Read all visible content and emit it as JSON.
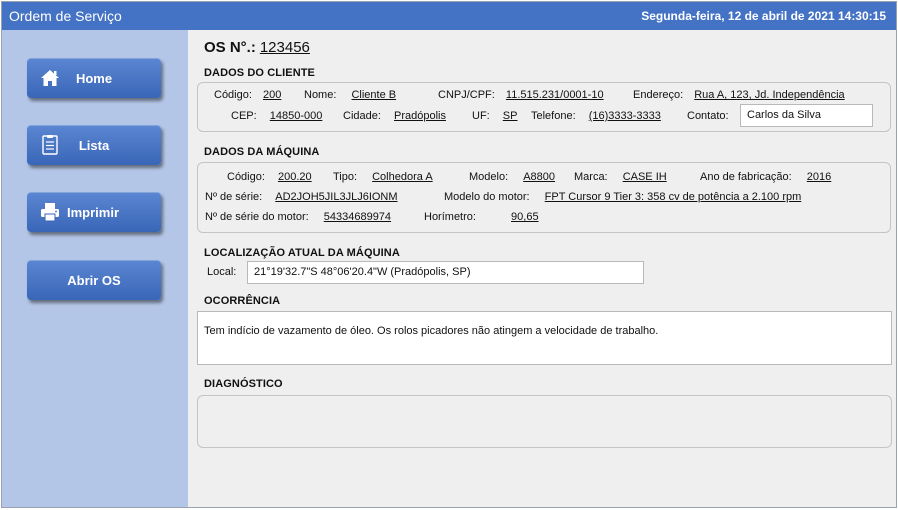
{
  "window": {
    "title": "Ordem de Serviço",
    "datetime": "Segunda-feira, 12 de abril de 2021 14:30:15"
  },
  "colors": {
    "titlebar": "#4472c4",
    "sidebar": "#b4c6e7",
    "button": "#4472c4",
    "content_bg": "#efefef"
  },
  "sidebar": {
    "home_label": "Home",
    "lista_label": "Lista",
    "imprimir_label": "Imprimir",
    "abrir_label": "Abrir OS",
    "icons": {
      "home": "home-icon",
      "lista": "list-icon",
      "imprimir": "printer-icon"
    }
  },
  "os": {
    "label": "OS N°.:",
    "number": "123456"
  },
  "cliente": {
    "section_title": "DADOS DO CLIENTE",
    "codigo_label": "Código:",
    "codigo": "200",
    "nome_label": "Nome:",
    "nome": "Cliente B",
    "cnpj_label": "CNPJ/CPF:",
    "cnpj": "11.515.231/0001-10",
    "endereco_label": "Endereço:",
    "endereco": "Rua A, 123, Jd. Independência",
    "cep_label": "CEP:",
    "cep": "14850-000",
    "cidade_label": "Cidade:",
    "cidade": "Pradópolis",
    "uf_label": "UF:",
    "uf": "SP",
    "telefone_label": "Telefone:",
    "telefone": "(16)3333-3333",
    "contato_label": "Contato:",
    "contato": "Carlos da Silva"
  },
  "maquina": {
    "section_title": "DADOS DA MÁQUINA",
    "codigo_label": "Código:",
    "codigo": "200.20",
    "tipo_label": "Tipo:",
    "tipo": "Colhedora A",
    "modelo_label": "Modelo:",
    "modelo": "A8800",
    "marca_label": "Marca:",
    "marca": "CASE IH",
    "ano_label": "Ano de fabricação:",
    "ano": "2016",
    "serie_label": "Nº de série:",
    "serie": "AD2JOH5JIL3JLJ6IONM",
    "modelo_motor_label": "Modelo do motor:",
    "modelo_motor": "FPT Cursor 9 Tier 3: 358 cv de potência a 2.100 rpm",
    "serie_motor_label": "Nº de série do motor:",
    "serie_motor": "54334689974",
    "horimetro_label": "Horímetro:",
    "horimetro": "90,65"
  },
  "localizacao": {
    "section_title": "LOCALIZAÇÃO ATUAL DA MÁQUINA",
    "local_label": "Local:",
    "local": "21°19'32.7\"S 48°06'20.4\"W (Pradópolis, SP)"
  },
  "ocorrencia": {
    "section_title": "OCORRÊNCIA",
    "text": "Tem indício de vazamento de óleo. Os rolos picadores não atingem a velocidade de trabalho."
  },
  "diagnostico": {
    "section_title": "DIAGNÓSTICO",
    "text": ""
  }
}
